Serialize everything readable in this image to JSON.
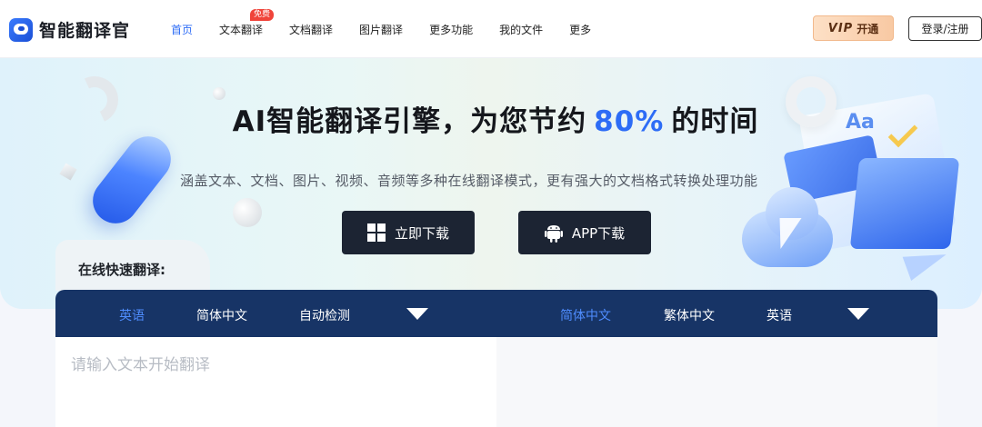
{
  "header": {
    "logo_text": "智能翻译官",
    "nav": [
      {
        "label": "首页",
        "active": true
      },
      {
        "label": "文本翻译",
        "badge": "免费"
      },
      {
        "label": "文档翻译"
      },
      {
        "label": "图片翻译"
      },
      {
        "label": "更多功能"
      },
      {
        "label": "我的文件"
      },
      {
        "label": "更多"
      }
    ],
    "vip_mark": "VIP",
    "vip_label": "开通",
    "login_label": "登录/注册"
  },
  "hero": {
    "title_prefix": "AI智能翻译引擎，为您节约",
    "title_highlight": "80%",
    "title_suffix": "的时间",
    "subtitle": "涵盖文本、文档、图片、视频、音频等多种在线翻译模式，更有强大的文档格式转换处理功能",
    "download_windows_label": "立即下载",
    "download_app_label": "APP下载"
  },
  "translator": {
    "section_label": "在线快速翻译:",
    "source_langs": [
      "英语",
      "简体中文",
      "自动检测"
    ],
    "target_langs": [
      "简体中文",
      "繁体中文",
      "英语"
    ],
    "input_placeholder": "请输入文本开始翻译"
  },
  "colors": {
    "accent": "#2d6cf6",
    "lang_bar": "#173466",
    "button_dark": "#1c2433"
  }
}
